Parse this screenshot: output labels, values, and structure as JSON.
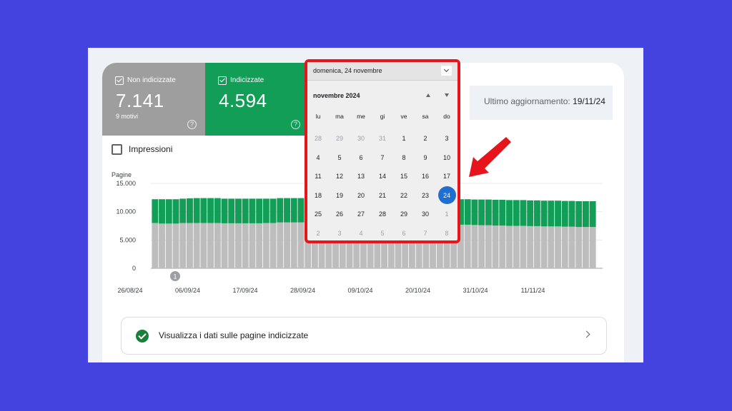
{
  "tiles": {
    "not_indexed": {
      "label": "Non indicizzate",
      "value": "7.141",
      "sub": "9 motivi",
      "color": "#9e9e9e"
    },
    "indexed": {
      "label": "Indicizzate",
      "value": "4.594",
      "color": "#129e57"
    },
    "help_glyph": "?"
  },
  "update": {
    "label": "Ultimo aggiornamento:",
    "date": "19/11/24"
  },
  "impressions": {
    "label": "Impressioni"
  },
  "datepicker": {
    "header_date": "domenica, 24 novembre",
    "month": "novembre 2024",
    "weekdays": [
      "lu",
      "ma",
      "me",
      "gi",
      "ve",
      "sa",
      "do"
    ],
    "weeks": [
      [
        "28",
        "29",
        "30",
        "31",
        "1",
        "2",
        "3"
      ],
      [
        "4",
        "5",
        "6",
        "7",
        "8",
        "9",
        "10"
      ],
      [
        "11",
        "12",
        "13",
        "14",
        "15",
        "16",
        "17"
      ],
      [
        "18",
        "19",
        "20",
        "21",
        "22",
        "23",
        "24"
      ],
      [
        "25",
        "26",
        "27",
        "28",
        "29",
        "30",
        "1"
      ],
      [
        "2",
        "3",
        "4",
        "5",
        "6",
        "7",
        "8"
      ]
    ],
    "selected": "24",
    "accent": "#1e6fd0",
    "highlight_color": "#e8141c"
  },
  "annotation_row": {
    "label": "Visualizza i dati sulle pagine indicizzate"
  },
  "chart_data": {
    "type": "bar",
    "ylabel": "Pagine",
    "yticks": [
      "0",
      "5.000",
      "10.000",
      "15.000"
    ],
    "ylim": [
      0,
      15000
    ],
    "xticks": [
      "26/08/24",
      "06/09/24",
      "17/09/24",
      "28/09/24",
      "09/10/24",
      "20/10/24",
      "31/10/24",
      "11/11/24"
    ],
    "annotation_marker": "1",
    "series": [
      {
        "name": "Non indicizzate",
        "color": "#bdbdbd",
        "values": [
          8000,
          7900,
          7900,
          7900,
          8000,
          8000,
          8000,
          8000,
          8000,
          8000,
          7950,
          7950,
          7950,
          7950,
          7950,
          7950,
          8000,
          8000,
          8100,
          8100,
          8100,
          8100,
          8100,
          8100,
          8100,
          8000,
          8000,
          8000,
          8000,
          7950,
          7950,
          7950,
          7950,
          7950,
          7950,
          7900,
          7900,
          7900,
          7900,
          7850,
          7850,
          7850,
          7800,
          7800,
          7700,
          7700,
          7650,
          7600,
          7600,
          7550,
          7550,
          7500,
          7500,
          7500,
          7450,
          7450,
          7400,
          7400,
          7400,
          7350,
          7350,
          7300,
          7300,
          7300
        ]
      },
      {
        "name": "Indicizzate",
        "color": "#129e57",
        "values": [
          4200,
          4300,
          4300,
          4300,
          4300,
          4350,
          4400,
          4400,
          4400,
          4400,
          4350,
          4350,
          4350,
          4350,
          4350,
          4350,
          4300,
          4300,
          4300,
          4300,
          4300,
          4300,
          4300,
          4300,
          4300,
          4350,
          4350,
          4350,
          4350,
          4400,
          4400,
          4400,
          4400,
          4400,
          4400,
          4400,
          4400,
          4450,
          4450,
          4450,
          4450,
          4450,
          4450,
          4450,
          4500,
          4500,
          4500,
          4550,
          4550,
          4550,
          4550,
          4550,
          4550,
          4550,
          4550,
          4550,
          4550,
          4550,
          4550,
          4550,
          4550,
          4550,
          4550,
          4550
        ]
      }
    ]
  }
}
